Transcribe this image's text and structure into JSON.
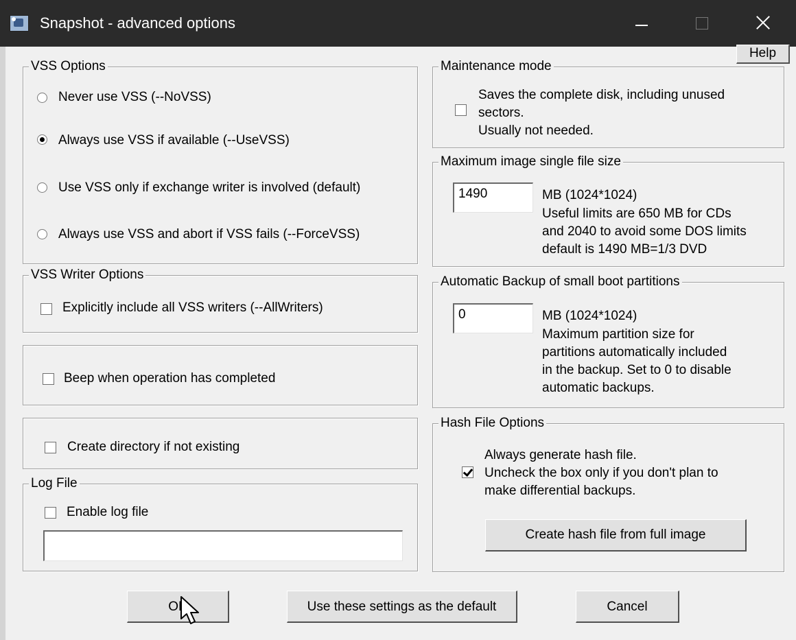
{
  "window": {
    "title": "Snapshot - advanced options"
  },
  "help_button": "Help",
  "vss_options": {
    "title": "VSS Options",
    "options": [
      {
        "label": "Never use VSS  (--NoVSS)",
        "selected": false
      },
      {
        "label": "Always use VSS if available (--UseVSS)",
        "selected": true
      },
      {
        "label": "Use VSS only if exchange writer is involved (default)",
        "selected": false
      },
      {
        "label": "Always use VSS and abort if VSS fails (--ForceVSS)",
        "selected": false
      }
    ]
  },
  "vss_writer_options": {
    "title": "VSS Writer Options",
    "include_all_writers": {
      "label": "Explicitly include all VSS writers (--AllWriters)",
      "checked": false
    }
  },
  "beep": {
    "label": "Beep when operation has completed",
    "checked": false
  },
  "create_directory": {
    "label": "Create directory if not existing",
    "checked": false
  },
  "log_file": {
    "title": "Log File",
    "enable": {
      "label": "Enable log file",
      "checked": false
    },
    "path": ""
  },
  "maintenance_mode": {
    "title": "Maintenance mode",
    "checked": false,
    "description": "Saves the complete disk, including unused\nsectors.\nUsually not needed."
  },
  "max_image_size": {
    "title": "Maximum image single file size",
    "value": "1490",
    "unit": "MB (1024*1024)",
    "description": "Useful limits are 650 MB for CDs\nand 2040 to avoid some DOS limits\ndefault is 1490 MB=1/3 DVD"
  },
  "auto_backup": {
    "title": "Automatic Backup of small boot partitions",
    "value": "0",
    "unit": "MB (1024*1024)",
    "description": "Maximum partition size for\npartitions automatically included\nin the backup. Set to 0 to disable\nautomatic backups."
  },
  "hash_file_options": {
    "title": "Hash File Options",
    "always_generate": {
      "checked": true,
      "description": "Always generate hash file.\nUncheck the box only if you don't plan to\nmake differential backups."
    },
    "create_button": "Create hash file from full image"
  },
  "footer": {
    "ok": "OK",
    "default": "Use these settings as the default",
    "cancel": "Cancel"
  },
  "colors": {
    "titlebar": "#2b2b2b",
    "dialog": "#f0f0f0"
  }
}
